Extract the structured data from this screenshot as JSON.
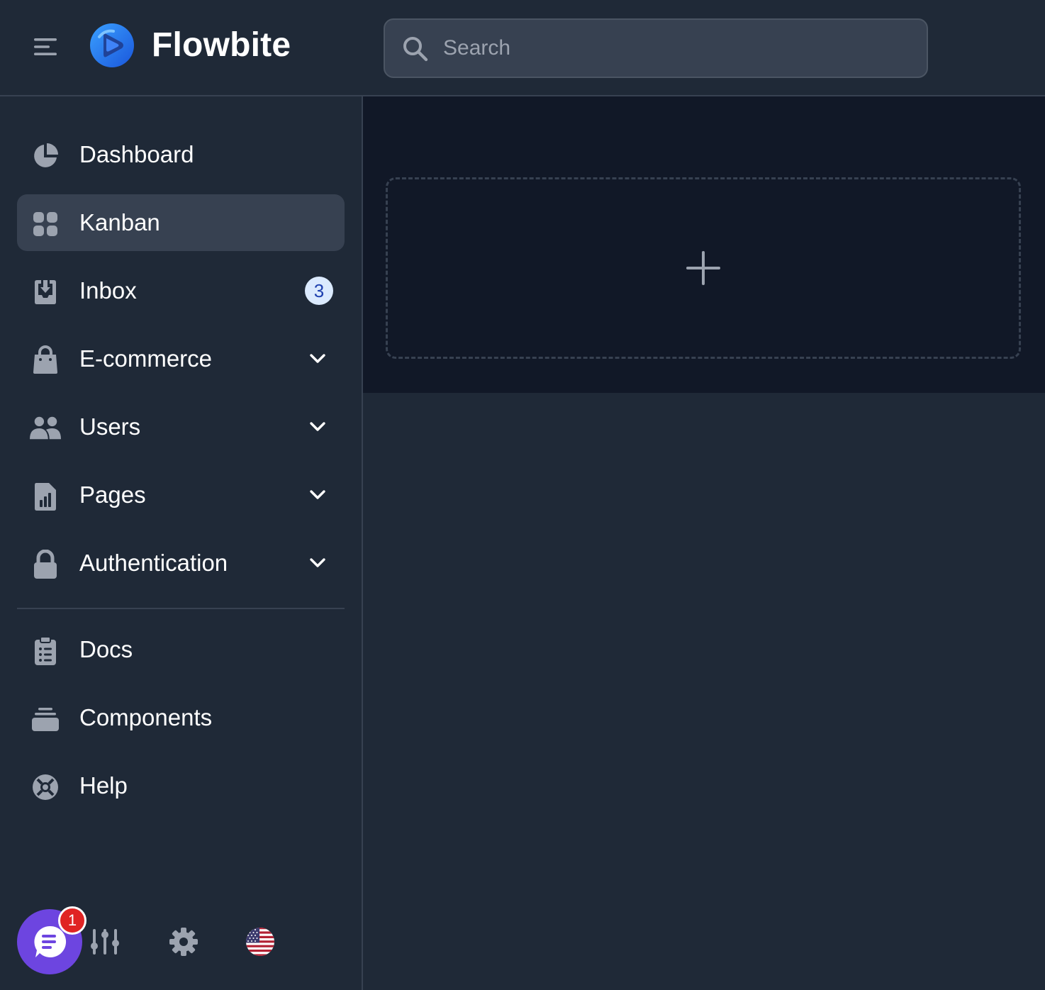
{
  "header": {
    "brand": "Flowbite",
    "search": {
      "placeholder": "Search",
      "value": ""
    }
  },
  "sidebar": {
    "items": [
      {
        "label": "Dashboard",
        "icon": "chart-pie-icon",
        "active": false
      },
      {
        "label": "Kanban",
        "icon": "view-grid-icon",
        "active": true
      },
      {
        "label": "Inbox",
        "icon": "inbox-in-icon",
        "badge": "3"
      },
      {
        "label": "E-commerce",
        "icon": "shopping-bag-icon",
        "expandable": true
      },
      {
        "label": "Users",
        "icon": "users-icon",
        "expandable": true
      },
      {
        "label": "Pages",
        "icon": "document-report-icon",
        "expandable": true
      },
      {
        "label": "Authentication",
        "icon": "lock-closed-icon",
        "expandable": true
      }
    ],
    "secondary_items": [
      {
        "label": "Docs",
        "icon": "clipboard-list-icon"
      },
      {
        "label": "Components",
        "icon": "collection-icon"
      },
      {
        "label": "Help",
        "icon": "support-icon"
      }
    ],
    "chat_badge": "1"
  },
  "colors": {
    "background": "#1f2937",
    "kanban_background": "#111827",
    "active_item": "#374151",
    "chat_button": "#6d45e0",
    "notification": "#e02424",
    "badge_bg": "#dbeafe",
    "badge_text": "#1e40af"
  }
}
